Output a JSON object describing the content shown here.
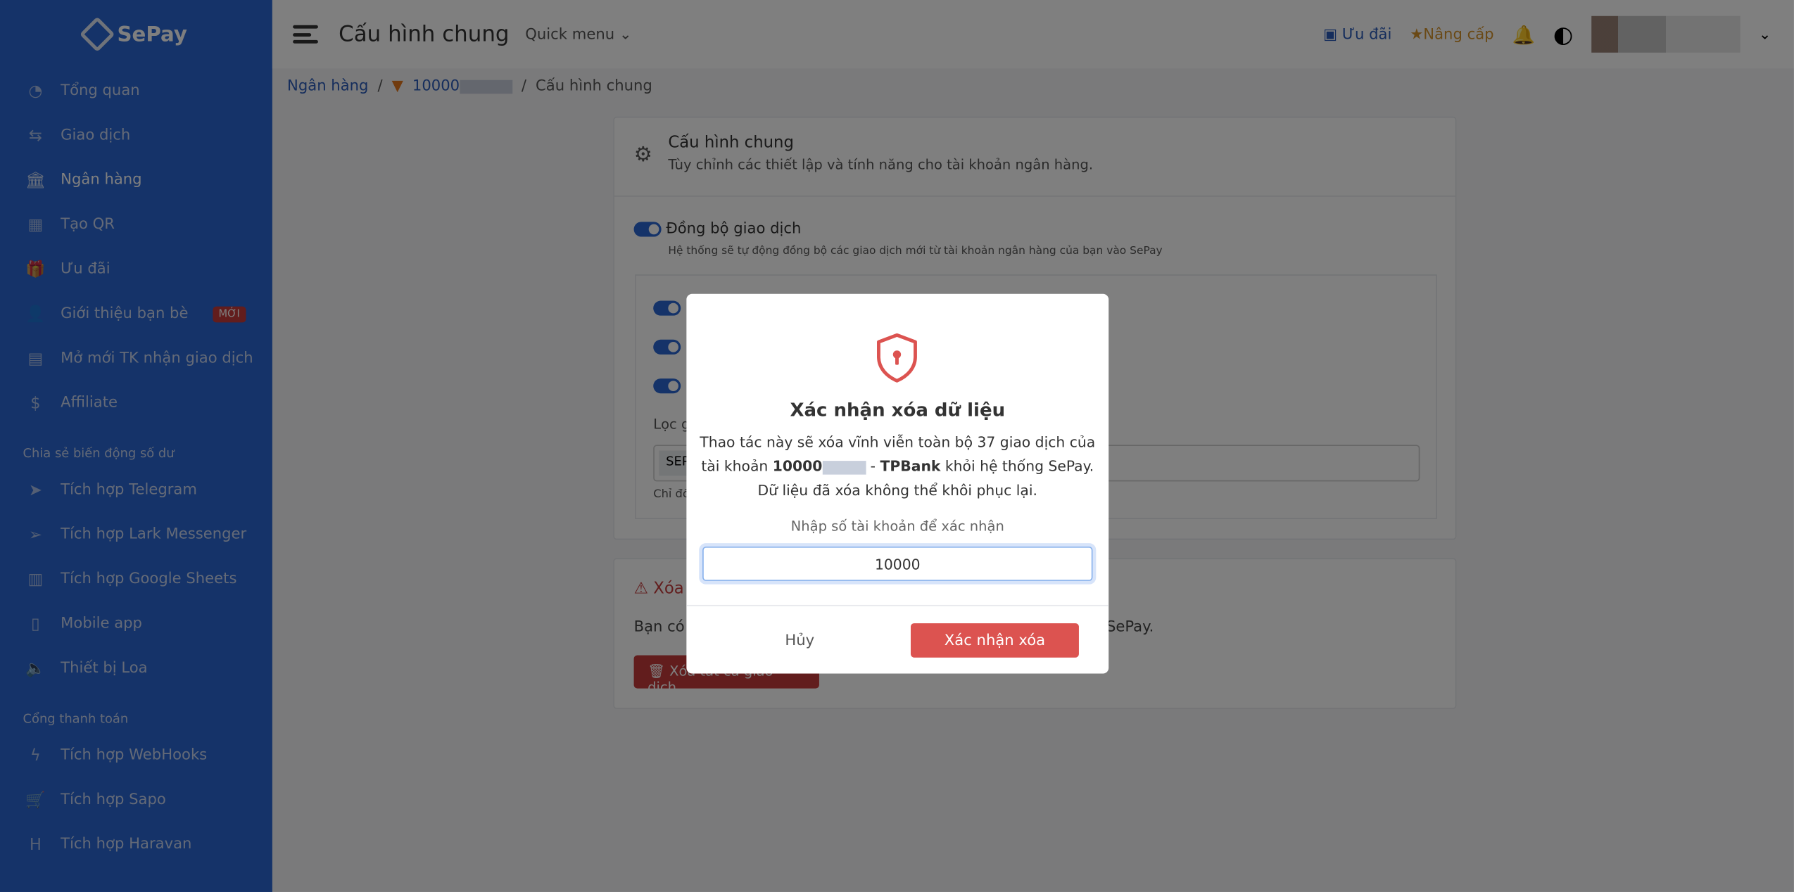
{
  "brand": "SePay",
  "sidebar": {
    "items": [
      {
        "label": "Tổng quan",
        "icon": "dashboard-icon",
        "glyph": "◔"
      },
      {
        "label": "Giao dịch",
        "icon": "transfer-icon",
        "glyph": "⇆"
      },
      {
        "label": "Ngân hàng",
        "icon": "bank-icon",
        "glyph": "🏛"
      },
      {
        "label": "Tạo QR",
        "icon": "qr-icon",
        "glyph": "▦"
      },
      {
        "label": "Ưu đãi",
        "icon": "gift-icon",
        "glyph": "🎁"
      },
      {
        "label": "Giới thiệu bạn bè",
        "icon": "user-plus-icon",
        "glyph": "👤",
        "badge": "MỚI"
      },
      {
        "label": "Mở mới TK nhận giao dịch",
        "icon": "building-plus-icon",
        "glyph": "▤"
      },
      {
        "label": "Affiliate",
        "icon": "dollar-icon",
        "glyph": "$"
      }
    ],
    "section1": "Chia sẻ biến động số dư",
    "items2": [
      {
        "label": "Tích hợp Telegram",
        "icon": "telegram-icon",
        "glyph": "➤"
      },
      {
        "label": "Tích hợp Lark Messenger",
        "icon": "send-icon",
        "glyph": "➢"
      },
      {
        "label": "Tích hợp Google Sheets",
        "icon": "sheet-icon",
        "glyph": "▥"
      },
      {
        "label": "Mobile app",
        "icon": "mobile-icon",
        "glyph": "▯"
      },
      {
        "label": "Thiết bị Loa",
        "icon": "speaker-icon",
        "glyph": "🔈"
      }
    ],
    "section2": "Cổng thanh toán",
    "items3": [
      {
        "label": "Tích hợp WebHooks",
        "icon": "bolt-icon",
        "glyph": "ϟ"
      },
      {
        "label": "Tích hợp Sapo",
        "icon": "cart-icon",
        "glyph": "🛒"
      },
      {
        "label": "Tích hợp Haravan",
        "icon": "haravan-icon",
        "glyph": "H"
      }
    ]
  },
  "header": {
    "title": "Cấu hình chung",
    "quick_menu": "Quick menu ⌄",
    "promo": "Ưu đãi",
    "upgrade": "Nâng cấp"
  },
  "breadcrumb": {
    "bank": "Ngân hàng",
    "account": "10000",
    "current": "Cấu hình chung"
  },
  "card": {
    "title": "Cấu hình chung",
    "subtitle": "Tùy chỉnh các thiết lập và tính năng cho tài khoản ngân hàng.",
    "sync_label": "Đồng bộ giao dịch",
    "sync_desc": "Hệ thống sẽ tự động đồng bộ các giao dịch mới từ tài khoản ngân hàng của bạn vào SePay",
    "filter_label": "Lọc g",
    "filter_tag": "SEP",
    "filter_hint": "Chỉ đồ"
  },
  "danger": {
    "title": "Xóa",
    "text": "Bạn có t",
    "text_end": "SePay.",
    "button": "Xóa tất cả giao dịch"
  },
  "modal": {
    "title": "Xác nhận xóa dữ liệu",
    "body1": "Thao tác này sẽ xóa vĩnh viễn toàn bộ 37 giao dịch của",
    "body2a": "tài khoản ",
    "account": "10000",
    "body2b": " - ",
    "bank": "TPBank",
    "body2c": " khỏi hệ thống SePay.",
    "body3": "Dữ liệu đã xóa không thể khôi phục lại.",
    "input_label": "Nhập số tài khoản để xác nhận",
    "input_value": "10000",
    "cancel": "Hủy",
    "confirm": "Xác nhận xóa"
  },
  "colors": {
    "sidebar": "#2a66d2",
    "danger": "#dc5350",
    "accent": "#2a5ab8"
  }
}
